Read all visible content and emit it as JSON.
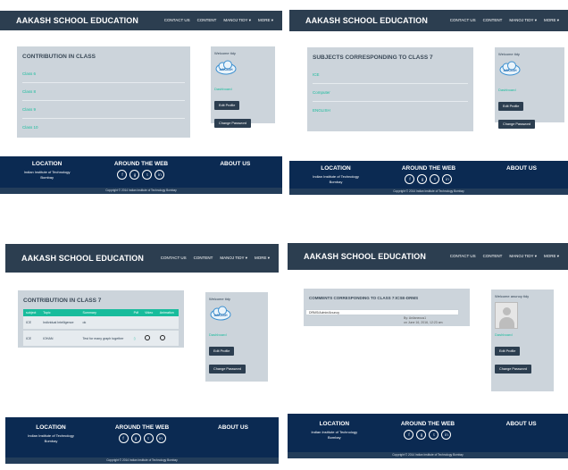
{
  "brand": "AAKASH SCHOOL EDUCATION",
  "nav": [
    "CONTACT US",
    "CONTENT",
    "MANOJ TIDY ▾",
    "MORE ▾"
  ],
  "sidebar": {
    "welcome": "Welcome tidy",
    "logo_text": "AAKASH",
    "dashboard": "Dashboard",
    "edit_profile": "Edit Profile",
    "change_password": "Change Password"
  },
  "footer": {
    "location_title": "LOCATION",
    "location_line1": "Indian Institute of Technology",
    "location_line2": "Bombay",
    "around_title": "AROUND THE WEB",
    "about_title": "ABOUT US",
    "copyright": "Copyright © 2014 Indian Institute of Technology Bombay",
    "social": [
      "f",
      "g",
      "t",
      "in"
    ]
  },
  "panel1": {
    "title": "CONTRIBUTION IN CLASS",
    "links": [
      "Class 6",
      "Class 8",
      "Class 9",
      "Class 10"
    ]
  },
  "panel2": {
    "title": "SUBJECTS CORRESPONDING TO CLASS 7",
    "links": [
      "ICE",
      "Computer",
      "ENGLISH"
    ]
  },
  "panel3": {
    "title": "CONTRIBUTION IN CLASS 7",
    "headers": [
      "subject",
      "Topic",
      "Summary",
      "Pdf",
      "Video",
      "Animation"
    ],
    "rows": [
      [
        "ICE",
        "Individual Intelligence",
        "ok",
        "",
        "",
        ""
      ],
      [
        "ICE",
        "IOHAN",
        "Test for many graph together",
        "",
        "",
        ""
      ]
    ]
  },
  "panel4": {
    "title": "COMMENTS CORRESPONDING TO CLASS 7:ICSE-DRMS",
    "comment_text": "DRMS/Admin/Anunoy",
    "meta_line1": "By: Anilaneous1",
    "meta_line2": "on June 16, 2016, 12:23 am",
    "welcome": "Welcome anunoy tidy"
  }
}
